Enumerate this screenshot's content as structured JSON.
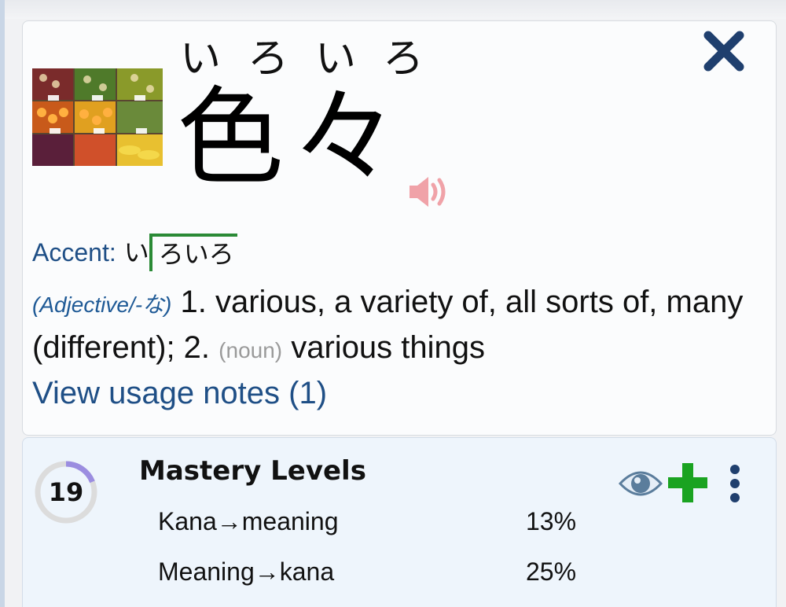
{
  "word": {
    "furigana": "いろいろ",
    "kanji": "色々"
  },
  "icons": {
    "close": "close-icon",
    "audio": "speaker-icon",
    "eye": "eye-icon",
    "add": "plus-icon",
    "more": "more-vertical-icon"
  },
  "accent": {
    "label": "Accent",
    "colon": ":",
    "low": "い",
    "high": "ろいろ"
  },
  "definition": {
    "pos": "(Adjective/-な)",
    "sense1": "1. various, a variety of, all sorts of, many (different); 2.",
    "pos2": "(noun)",
    "sense2": "various things"
  },
  "usage_link": "View usage notes (1)",
  "mastery": {
    "title": "Mastery Levels",
    "level": "19",
    "level_progress": 0.19,
    "rows": [
      {
        "label": "Kana→meaning",
        "value": "13%"
      },
      {
        "label": "Meaning→kana",
        "value": "25%"
      }
    ]
  },
  "colors": {
    "accent_blue": "#1f4f86",
    "close_navy": "#1f3f6e",
    "speaker_pink": "#f0a2a8",
    "plus_green": "#1aa321",
    "pitch_green": "#2a8a36",
    "ring_purple": "#9b8de0",
    "ring_grey": "#dcdcdc"
  }
}
